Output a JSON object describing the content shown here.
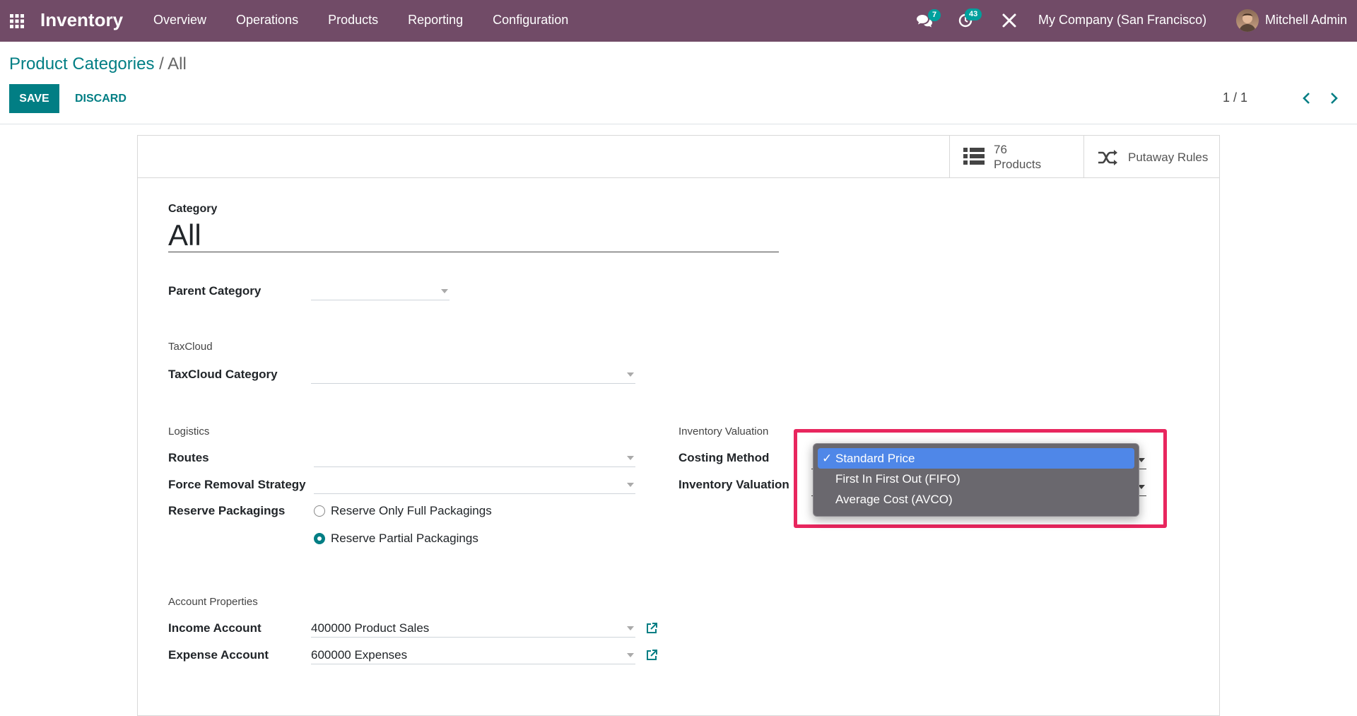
{
  "navbar": {
    "app_name": "Inventory",
    "menu": [
      "Overview",
      "Operations",
      "Products",
      "Reporting",
      "Configuration"
    ],
    "messages_badge": "7",
    "activities_badge": "43",
    "company": "My Company (San Francisco)",
    "user": "Mitchell Admin"
  },
  "breadcrumb": {
    "parent": "Product Categories",
    "separator": "/",
    "current": "All"
  },
  "toolbar": {
    "save_label": "SAVE",
    "discard_label": "DISCARD",
    "pager": "1 / 1"
  },
  "smart_buttons": {
    "products_count": "76",
    "products_label": "Products",
    "putaway_label": "Putaway Rules"
  },
  "form": {
    "category_label": "Category",
    "category_name": "All",
    "parent_category_label": "Parent Category",
    "taxcloud_section": "TaxCloud",
    "taxcloud_category_label": "TaxCloud Category",
    "logistics_section": "Logistics",
    "routes_label": "Routes",
    "removal_strategy_label": "Force Removal Strategy",
    "reserve_packagings_label": "Reserve Packagings",
    "reserve_options": [
      "Reserve Only Full Packagings",
      "Reserve Partial Packagings"
    ],
    "reserve_selected": "Reserve Partial Packagings",
    "valuation_section": "Inventory Valuation",
    "costing_method_label": "Costing Method",
    "inventory_valuation_label": "Inventory Valuation",
    "account_section": "Account Properties",
    "income_account_label": "Income Account",
    "income_account_value": "400000 Product Sales",
    "expense_account_label": "Expense Account",
    "expense_account_value": "600000 Expenses"
  },
  "dropdown": {
    "check_mark": "✓",
    "options": [
      "Standard Price",
      "First In First Out (FIFO)",
      "Average Cost (AVCO)"
    ],
    "selected": "Standard Price",
    "highlight_color": "#e8265e"
  },
  "colors": {
    "navbar": "#714b67",
    "primary": "#017e84",
    "badge": "#00a09d",
    "selection": "#4f87e8"
  }
}
